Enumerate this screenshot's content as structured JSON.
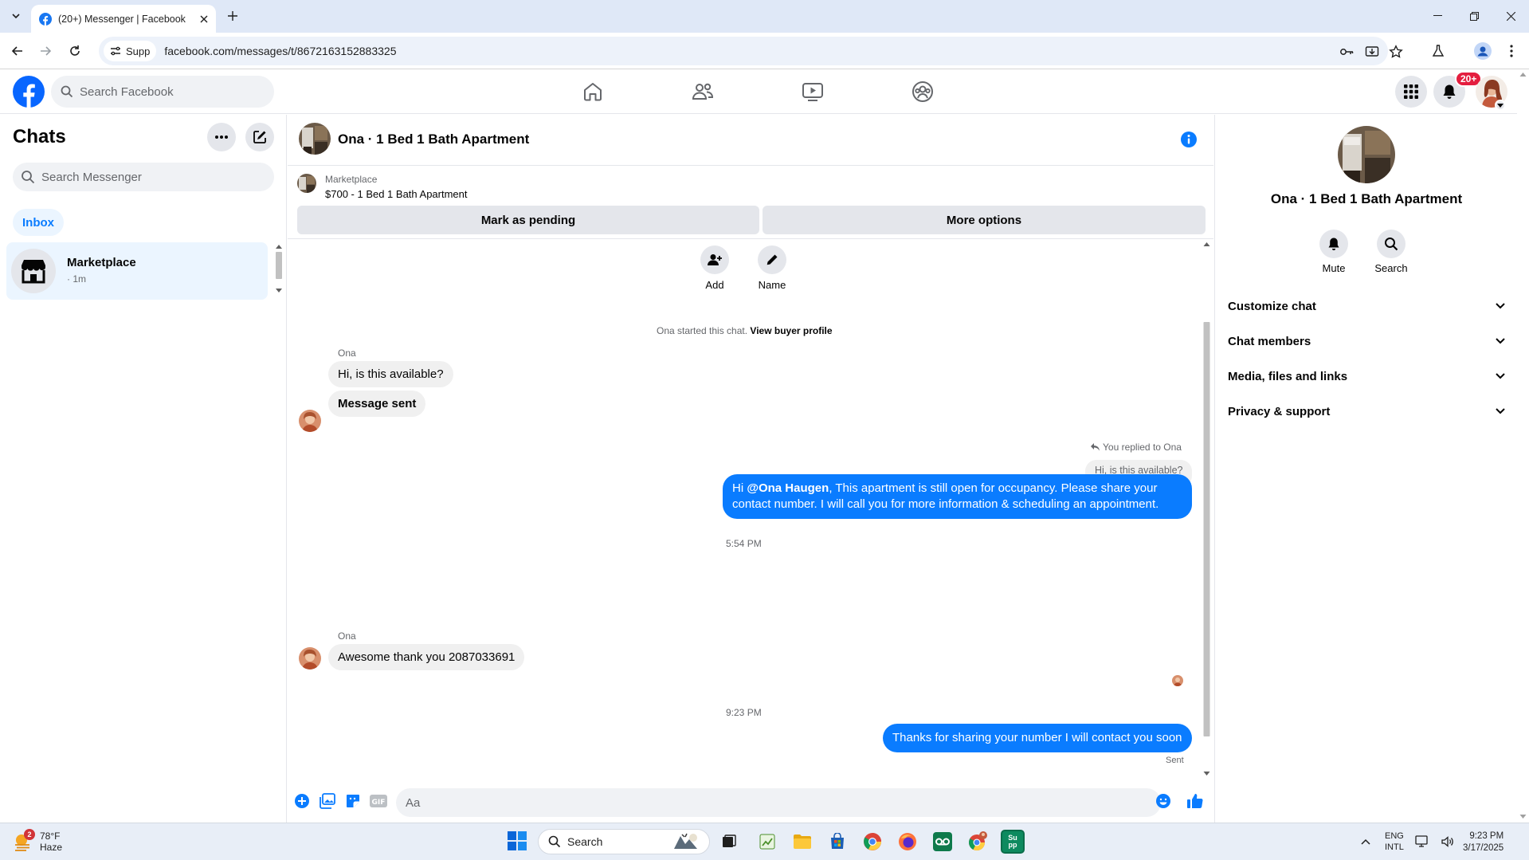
{
  "browser": {
    "tab_title": "(20+) Messenger | Facebook",
    "site_chip": "Supp",
    "url": "facebook.com/messages/t/8672163152883325"
  },
  "fb_header": {
    "search_placeholder": "Search Facebook",
    "notification_badge": "20+"
  },
  "left_panel": {
    "title": "Chats",
    "search_placeholder": "Search Messenger",
    "filter": "Inbox",
    "conversations": [
      {
        "name": "Marketplace",
        "time": "· 1m"
      }
    ]
  },
  "chat": {
    "title": "Ona · 1 Bed 1 Bath Apartment",
    "marketplace_label": "Marketplace",
    "listing": "$700 - 1 Bed 1 Bath Apartment",
    "mark_pending": "Mark as pending",
    "more_options": "More options",
    "actions": [
      {
        "label": "Add"
      },
      {
        "label": "Name"
      }
    ],
    "system_text": "Ona started this chat.",
    "system_link": "View buyer profile",
    "sender_1": "Ona",
    "msg_1": "Hi, is this available?",
    "msg_2": "Message sent",
    "reply_note": "You replied to Ona",
    "reply_quote": "Hi, is this available?",
    "out_1_prefix": "Hi ",
    "out_1_mention": "@Ona Haugen",
    "out_1_rest": ", This apartment is still open for occupancy. Please share your contact number. I will call you for more information & scheduling an appointment.",
    "time_1": "5:54 PM",
    "sender_2": "Ona",
    "msg_3": "Awesome thank you 2087033691",
    "time_2": "9:23 PM",
    "out_2": "Thanks for sharing your number I will contact you soon",
    "status": "Sent",
    "composer_placeholder": "Aa"
  },
  "right_panel": {
    "title": "Ona · 1 Bed 1 Bath Apartment",
    "mute": "Mute",
    "search": "Search",
    "sections": [
      "Customize chat",
      "Chat members",
      "Media, files and links",
      "Privacy & support"
    ]
  },
  "taskbar": {
    "weather_temp": "78°F",
    "weather_desc": "Haze",
    "weather_badge": "2",
    "search_placeholder": "Search",
    "lang_1": "ENG",
    "lang_2": "INTL",
    "time": "9:23 PM",
    "date": "3/17/2025",
    "app_label": "Su\npp"
  },
  "colors": {
    "messenger_blue": "#0a7cff",
    "fb_blue": "#1877f2",
    "notification_red": "#e41e3f"
  }
}
